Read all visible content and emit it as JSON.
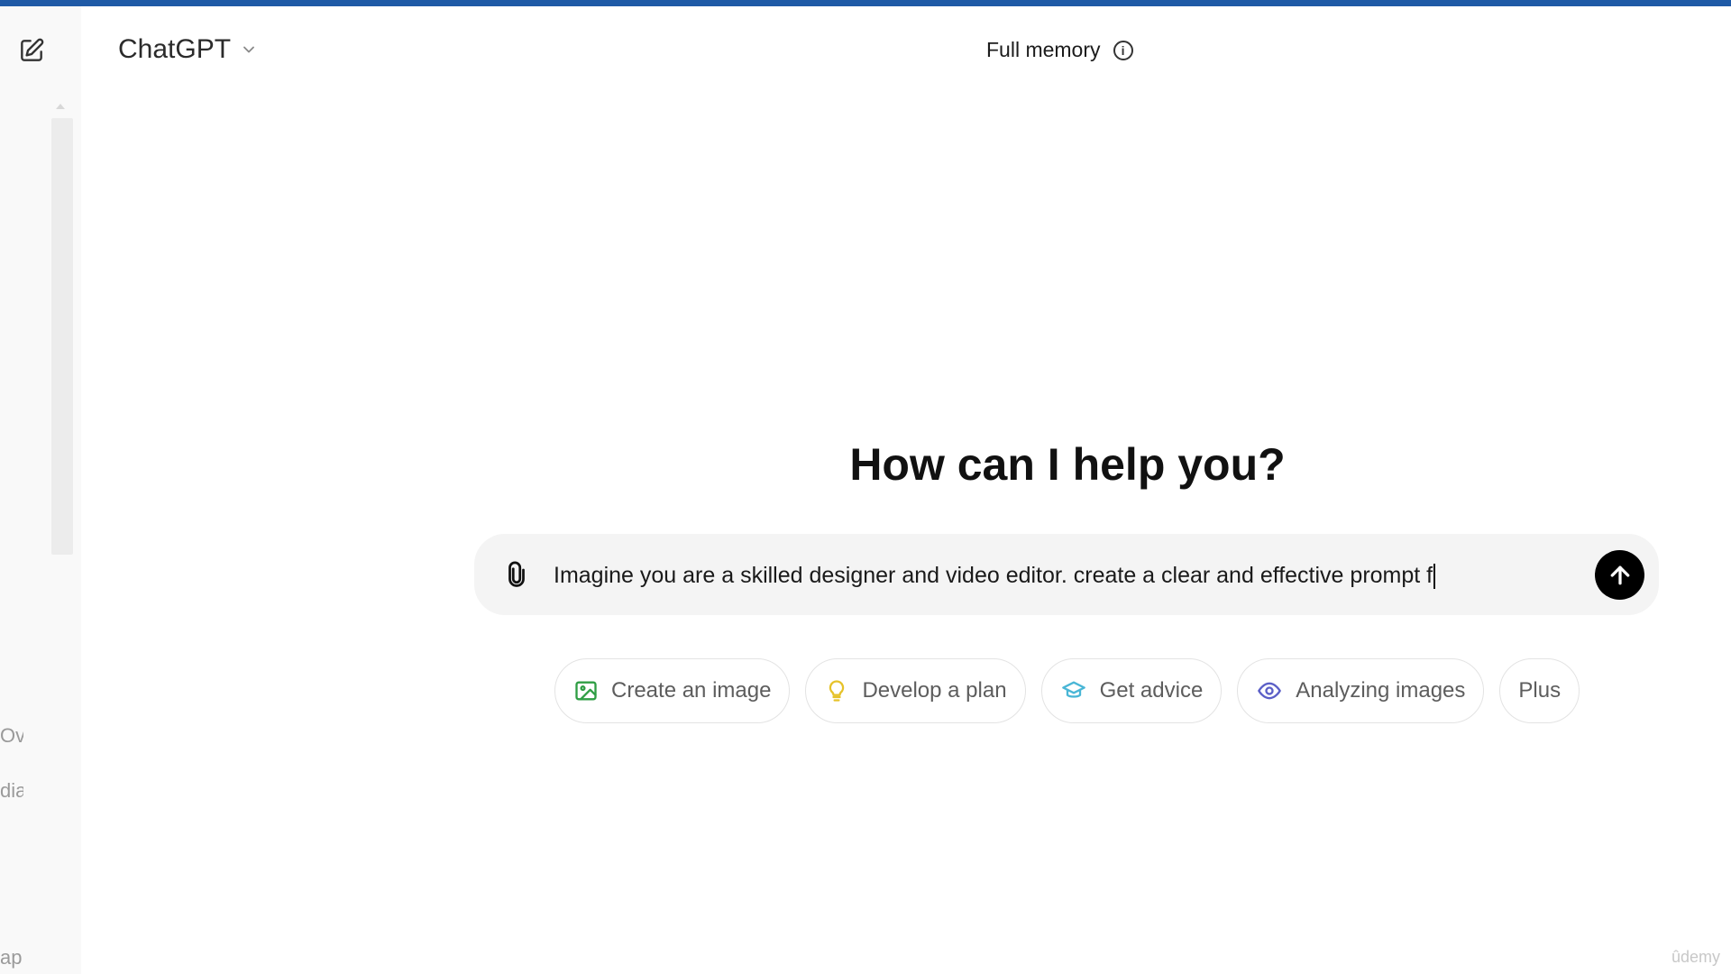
{
  "app": {
    "title": "ChatGPT",
    "mode_label": "Full memory"
  },
  "sidebar": {
    "clipped_texts": [
      "Ove",
      "dia",
      "ap"
    ]
  },
  "main": {
    "headline": "How can I help you?",
    "composer": {
      "value": "Imagine you are  a skilled designer and video editor. create a clear and effective prompt f"
    },
    "suggestions": [
      {
        "label": "Create an image",
        "icon": "image-icon",
        "color": "#2f9e44"
      },
      {
        "label": "Develop a plan",
        "icon": "lightbulb-icon",
        "color": "#e6c229"
      },
      {
        "label": "Get advice",
        "icon": "graduation-cap-icon",
        "color": "#49b6d6"
      },
      {
        "label": "Analyzing images",
        "icon": "eye-icon",
        "color": "#5b5fc7"
      },
      {
        "label": "Plus",
        "icon": "",
        "color": ""
      }
    ]
  },
  "watermark": "ûdemy",
  "colors": {
    "accent_bar": "#1f5aa6",
    "send_button": "#000000",
    "composer_bg": "#f4f4f4"
  }
}
